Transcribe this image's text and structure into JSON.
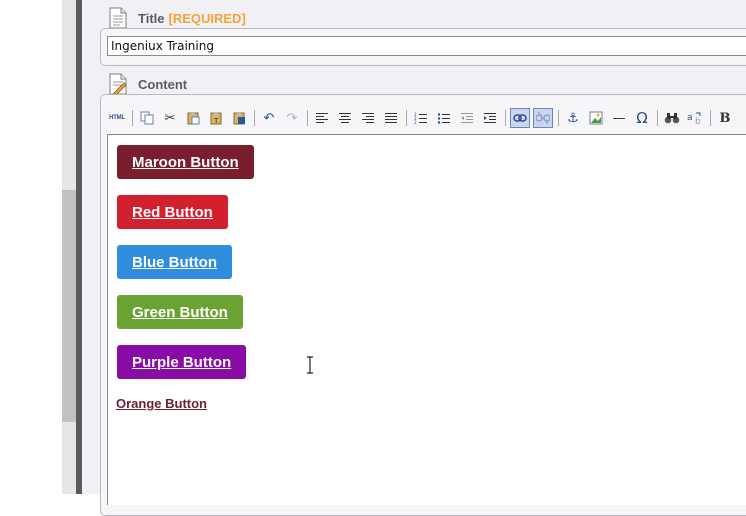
{
  "title_field": {
    "label": "Title",
    "required_tag": "[REQUIRED]",
    "value": "Ingeniux Training"
  },
  "content_field": {
    "label": "Content"
  },
  "toolbar": {
    "html_label": "HTML",
    "omega_glyph": "Ω",
    "bold_glyph": "B",
    "hr_glyph": "—"
  },
  "editor_buttons": [
    {
      "label": "Maroon Button",
      "color": "#7a1e2e"
    },
    {
      "label": "Red Button",
      "color": "#d3202e"
    },
    {
      "label": "Blue Button",
      "color": "#2f8de0"
    },
    {
      "label": "Green Button",
      "color": "#6ba332"
    },
    {
      "label": "Purple Button",
      "color": "#8a0ca6"
    }
  ],
  "orange_link": {
    "label": "Orange Button",
    "color": "#6d2131"
  },
  "colors": {
    "required": "#f3a534",
    "panel_bg": "#f1f1f5",
    "toolbar_icon": "#2b4f8f"
  }
}
